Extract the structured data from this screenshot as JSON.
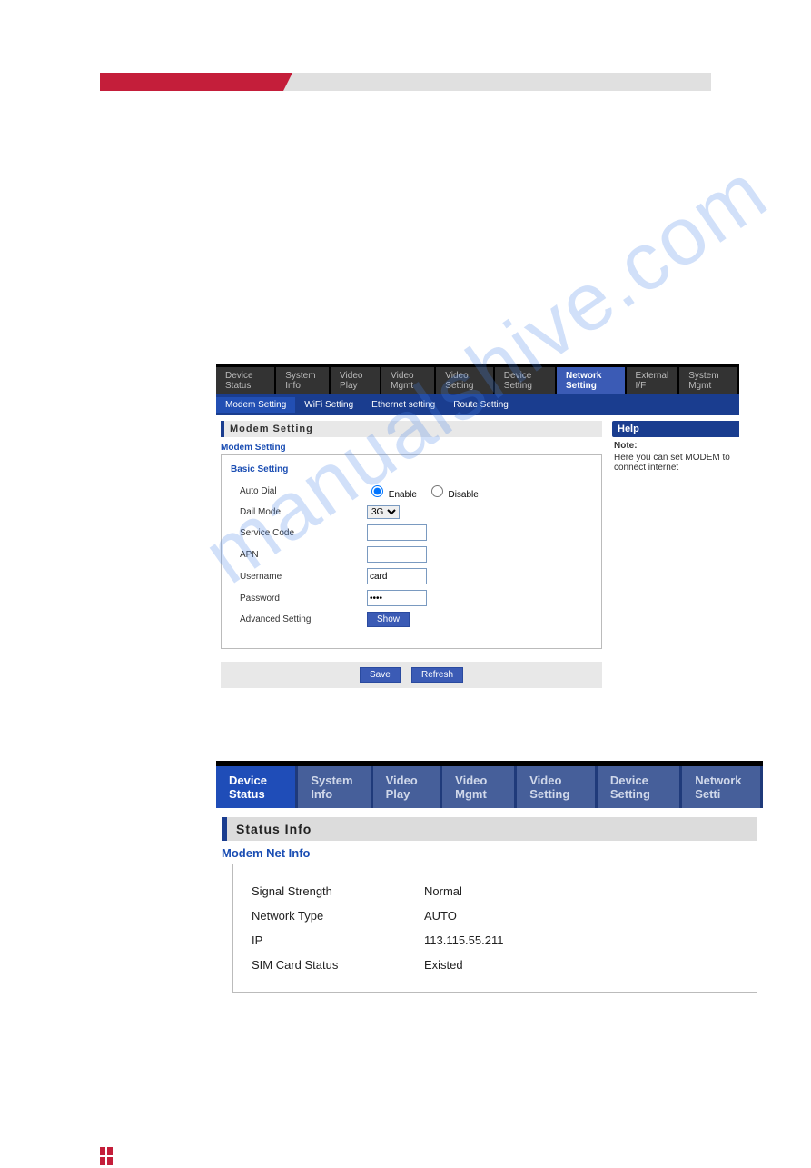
{
  "watermark": "manualshive.com",
  "topTabs": [
    {
      "label": "Device Status"
    },
    {
      "label": "System Info"
    },
    {
      "label": "Video Play"
    },
    {
      "label": "Video Mgmt"
    },
    {
      "label": "Video Setting"
    },
    {
      "label": "Device Setting"
    },
    {
      "label": "Network Setting"
    },
    {
      "label": "External I/F"
    },
    {
      "label": "System Mgmt"
    }
  ],
  "subTabs": [
    {
      "label": "Modem Setting"
    },
    {
      "label": "WiFi Setting"
    },
    {
      "label": "Ethernet setting"
    },
    {
      "label": "Route Setting"
    }
  ],
  "panelTitle": "Modem Setting",
  "sectionLabel": "Modem Setting",
  "fieldsetTitle": "Basic Setting",
  "form": {
    "autoDial": {
      "label": "Auto Dial",
      "enable": "Enable",
      "disable": "Disable"
    },
    "dialMode": {
      "label": "Dail Mode",
      "value": "3G"
    },
    "serviceCode": {
      "label": "Service Code",
      "value": ""
    },
    "apn": {
      "label": "APN",
      "value": ""
    },
    "username": {
      "label": "Username",
      "value": "card"
    },
    "password": {
      "label": "Password",
      "value": "••••"
    },
    "advanced": {
      "label": "Advanced Setting",
      "button": "Show"
    }
  },
  "buttons": {
    "save": "Save",
    "refresh": "Refresh"
  },
  "help": {
    "title": "Help",
    "noteLabel": "Note:",
    "noteText": "Here you can set MODEM to connect internet"
  },
  "status": {
    "tabs": [
      {
        "label": "Device Status"
      },
      {
        "label": "System Info"
      },
      {
        "label": "Video Play"
      },
      {
        "label": "Video Mgmt"
      },
      {
        "label": "Video Setting"
      },
      {
        "label": "Device Setting"
      },
      {
        "label": "Network Setti"
      }
    ],
    "panelTitle": "Status Info",
    "sectionLabel": "Modem Net Info",
    "rows": [
      {
        "label": "Signal Strength",
        "value": "Normal"
      },
      {
        "label": "Network Type",
        "value": "AUTO"
      },
      {
        "label": "IP",
        "value": "113.115.55.211"
      },
      {
        "label": "SIM Card Status",
        "value": "Existed"
      }
    ]
  }
}
